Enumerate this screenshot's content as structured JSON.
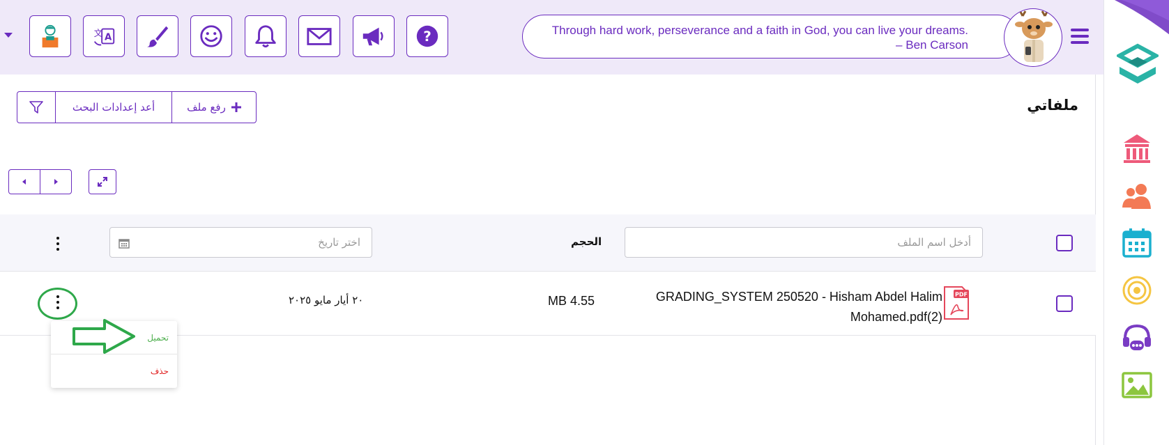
{
  "header": {
    "quote": "Through hard work, perseverance and a faith in God, you can live your dreams. – Ben Carson"
  },
  "toolbar": {
    "icons": [
      "student-avatar-icon",
      "translate-icon",
      "paint-brush-icon",
      "smiley-icon",
      "bell-icon",
      "envelope-icon",
      "megaphone-icon",
      "help-icon"
    ]
  },
  "page": {
    "title": "ملفاتي",
    "upload_label": "رفع ملف",
    "reset_label": "أعد إعدادات البحث"
  },
  "filters": {
    "name_placeholder": "أدخل اسم الملف",
    "size_header": "الحجم",
    "date_placeholder": "اختر تاريخ"
  },
  "files": [
    {
      "name": "GRADING_SYSTEM 250520 - Hisham Abdel Halim Mohamed.pdf(2)",
      "size": "MB 4.55",
      "date": "٢٠ أيار مايو ٢٠٢٥",
      "badge": "PDF"
    }
  ],
  "menu": {
    "download": "تحميل",
    "delete": "حذف"
  },
  "colors": {
    "accent": "#6a2bbf",
    "topbar_bg": "#efe9f9",
    "download": "#4cae4c",
    "delete": "#e02020",
    "annotation": "#2ea84a"
  }
}
